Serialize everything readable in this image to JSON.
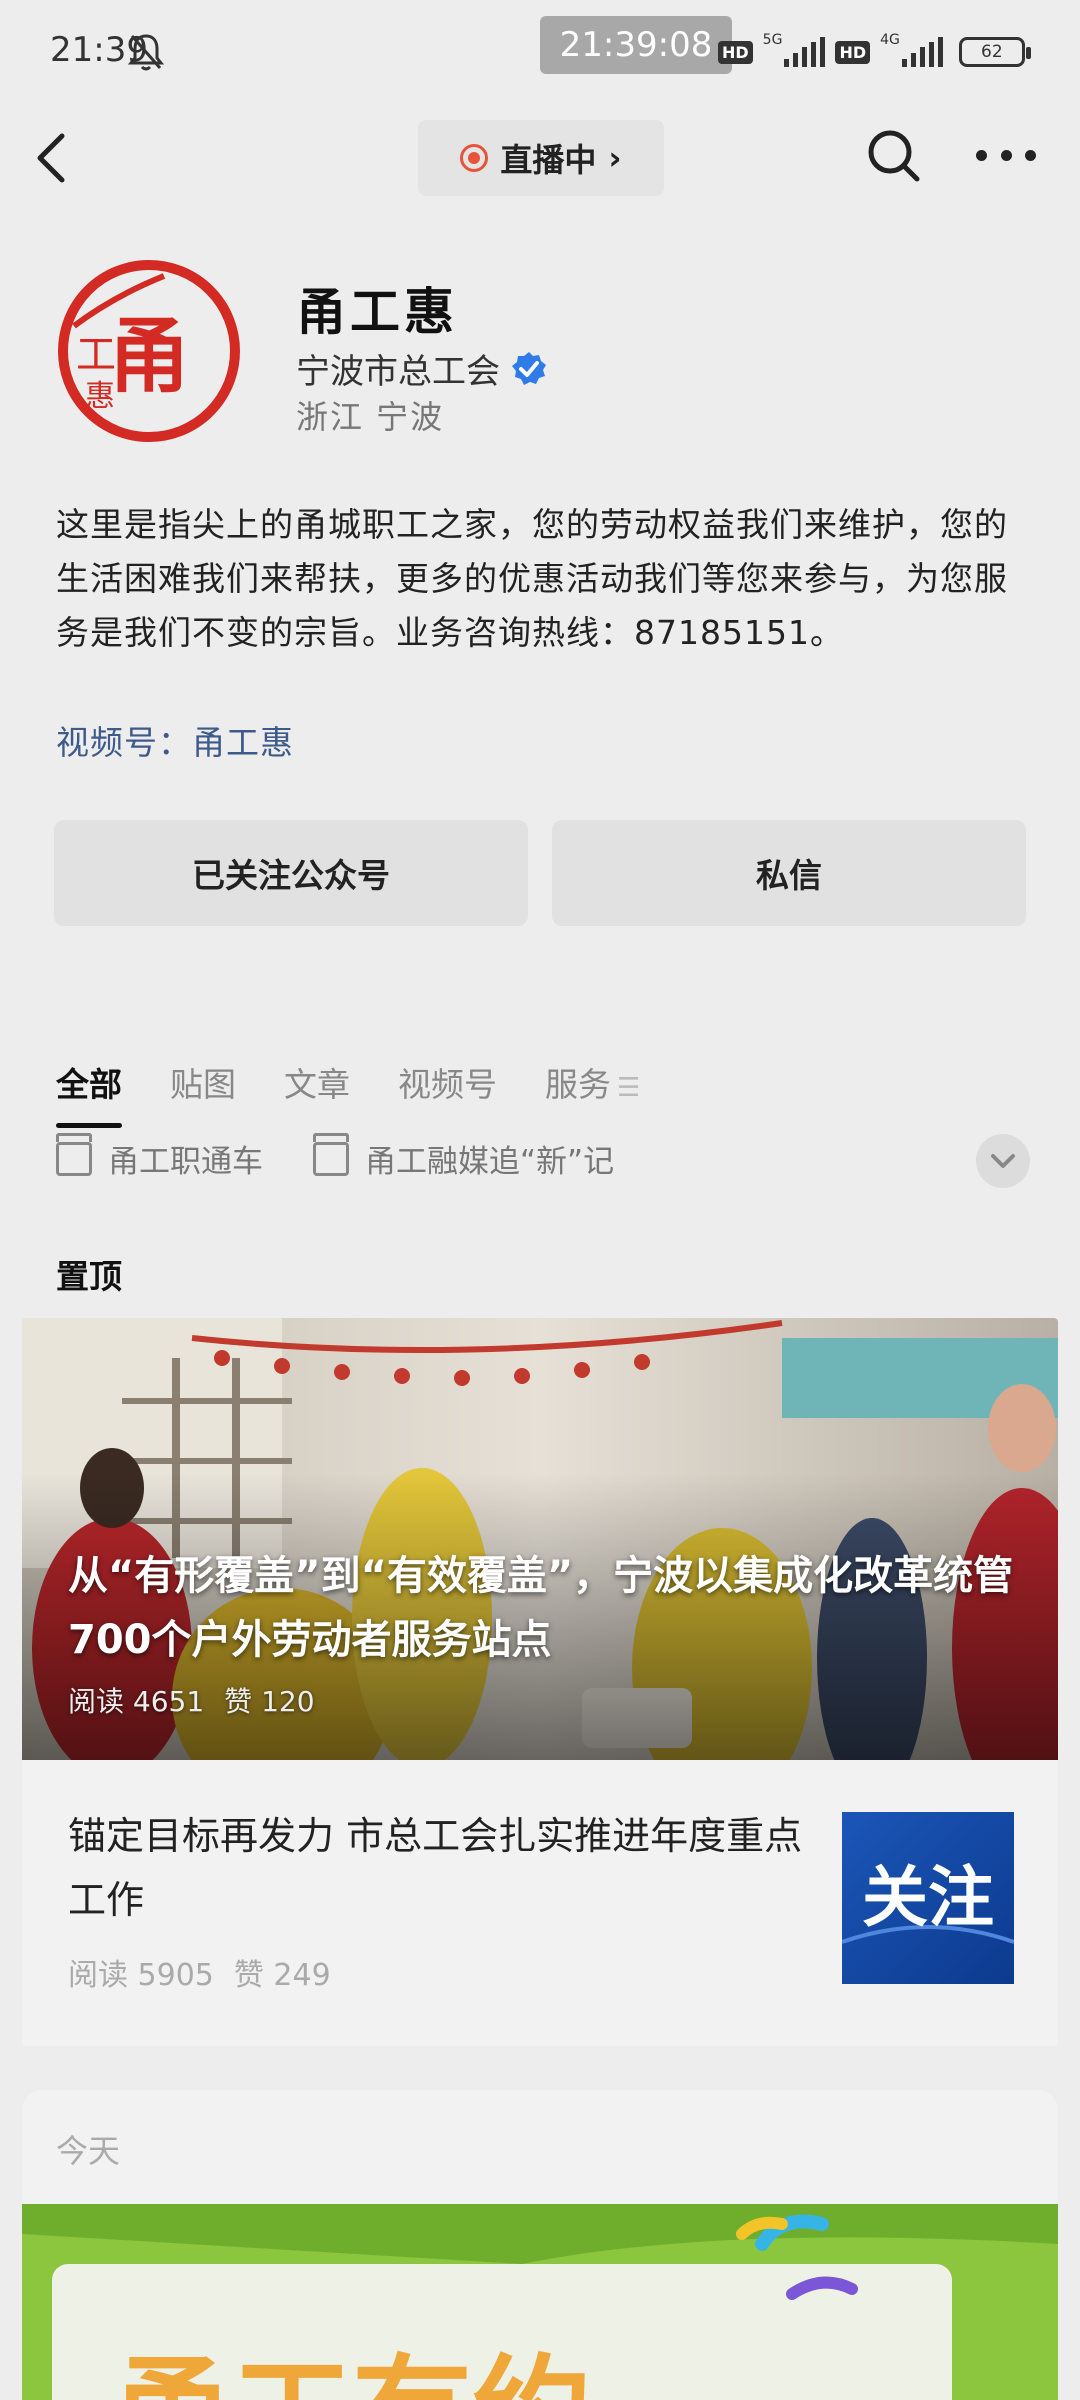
{
  "status_bar": {
    "time": "21:39",
    "center_clock": "21:39:08",
    "hd1": "HD",
    "net1": "5G",
    "hd2": "HD",
    "net2": "4G",
    "battery": "62"
  },
  "nav": {
    "live_label": "直播中",
    "live_chevron": "›"
  },
  "profile": {
    "logo_text": "工惠甬",
    "name": "甬工惠",
    "owner": "宁波市总工会",
    "location": "浙江 宁波",
    "description": "这里是指尖上的甬城职工之家，您的劳动权益我们来维护，您的生活困难我们来帮扶，更多的优惠活动我们等您来参与，为您服务是我们不变的宗旨。业务咨询热线：87185151。",
    "channel": "视频号：甬工惠"
  },
  "actions": {
    "follow": "已关注公众号",
    "message": "私信"
  },
  "tabs": [
    {
      "label": "全部"
    },
    {
      "label": "贴图"
    },
    {
      "label": "文章"
    },
    {
      "label": "视频号"
    },
    {
      "label": "服务"
    }
  ],
  "collections": [
    {
      "label": "甬工职通车"
    },
    {
      "label": "甬工融媒追“新”记"
    }
  ],
  "pinned_label": "置顶",
  "pinned_articles": [
    {
      "title": "从“有形覆盖”到“有效覆盖”，宁波以集成化改革统管700个户外劳动者服务站点",
      "reads": "阅读 4651",
      "likes": "赞 120"
    },
    {
      "title": "锚定目标再发力 市总工会扎实推进年度重点工作",
      "reads": "阅读 5905",
      "likes": "赞 249",
      "thumb_text": "关注"
    }
  ],
  "today": {
    "label": "今天",
    "banner_text": "甬工有约"
  },
  "colors": {
    "accent_red": "#e8543b",
    "link_blue": "#3d5a8a",
    "verified_blue": "#2f7be8",
    "logo_red": "#d42a24"
  }
}
